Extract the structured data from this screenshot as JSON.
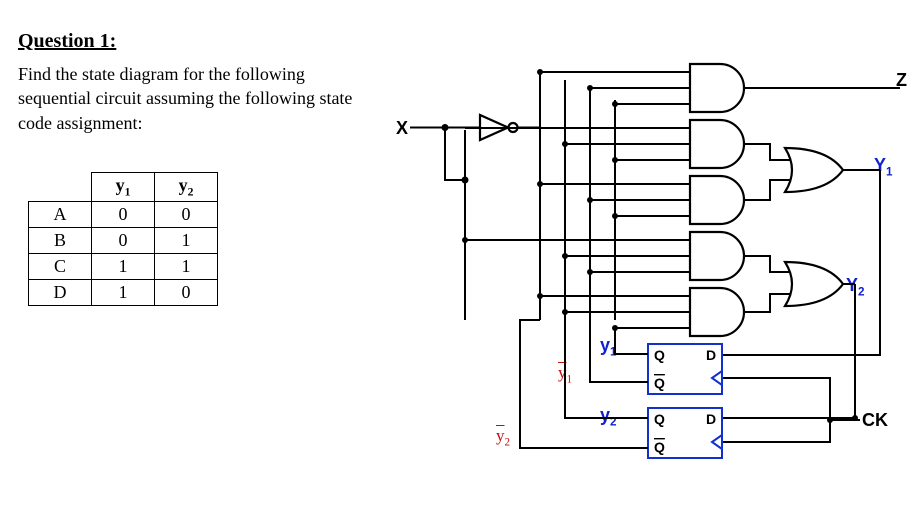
{
  "title": "Question 1:",
  "prompt": "Find the state diagram for the following sequential circuit assuming the following state code assignment:",
  "table": {
    "headers": {
      "col1": "y",
      "col1sub": "1",
      "col2": "y",
      "col2sub": "2"
    },
    "rows": [
      {
        "state": "A",
        "y1": "0",
        "y2": "0"
      },
      {
        "state": "B",
        "y1": "0",
        "y2": "1"
      },
      {
        "state": "C",
        "y1": "1",
        "y2": "1"
      },
      {
        "state": "D",
        "y1": "1",
        "y2": "0"
      }
    ]
  },
  "labels": {
    "x": "X",
    "z": "Z",
    "Y1": "Y",
    "Y1sub": "1",
    "Y2": "Y",
    "Y2sub": "2",
    "y1": "y",
    "y1sub": "1",
    "y1bar": "y",
    "y1barsub": "1",
    "y2": "y",
    "y2sub": "2",
    "y2bar": "y",
    "y2barsub": "2",
    "ck": "CK",
    "ff": {
      "Q": "Q",
      "Qbar": "Q",
      "D": "D"
    }
  },
  "chart_data": {
    "type": "circuit-diagram",
    "inputs": [
      "X"
    ],
    "outputs": [
      "Z"
    ],
    "flip_flops": [
      {
        "name": "FF1",
        "type": "D",
        "q": "y1",
        "qbar": "y1_bar",
        "d": "Y1",
        "clock": "CK"
      },
      {
        "name": "FF2",
        "type": "D",
        "q": "y2",
        "qbar": "y2_bar",
        "d": "Y2",
        "clock": "CK"
      }
    ],
    "next_state_logic": {
      "Y1": "OR of two AND gates fed by combinations of X, X', y1, y2",
      "Y2": "OR of two AND gates fed by combinations of X, X', y1, y2"
    },
    "output_logic": {
      "Z": "3-input AND gate fed by X' and present-state signals"
    },
    "state_encoding": [
      {
        "state": "A",
        "y1": 0,
        "y2": 0
      },
      {
        "state": "B",
        "y1": 0,
        "y2": 1
      },
      {
        "state": "C",
        "y1": 1,
        "y2": 1
      },
      {
        "state": "D",
        "y1": 1,
        "y2": 0
      }
    ],
    "notes": "Five 3-input AND gates feed two 2-input OR gates (Y1, Y2) and one direct output Z; X passes through a NOT gate producing X'."
  }
}
